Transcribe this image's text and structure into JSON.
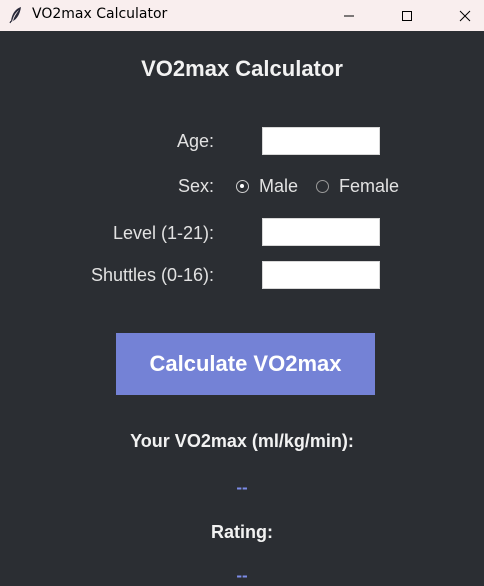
{
  "window": {
    "title": "VO2max Calculator",
    "icon": "feather-icon"
  },
  "app": {
    "heading": "VO2max Calculator",
    "form": {
      "age_label": "Age:",
      "age_value": "",
      "sex_label": "Sex:",
      "sex_options": [
        "Male",
        "Female"
      ],
      "sex_selected": "Male",
      "level_label": "Level (1-21):",
      "level_value": "",
      "shuttles_label": "Shuttles (0-16):",
      "shuttles_value": ""
    },
    "calculate_label": "Calculate VO2max",
    "result": {
      "vo2_label": "Your VO2max (ml/kg/min):",
      "vo2_value": "--",
      "rating_label": "Rating:",
      "rating_value": "--"
    }
  },
  "colors": {
    "background": "#2b2e33",
    "button": "#7482d6",
    "result_value": "#7c8ce8",
    "titlebar": "#f9eeee"
  }
}
